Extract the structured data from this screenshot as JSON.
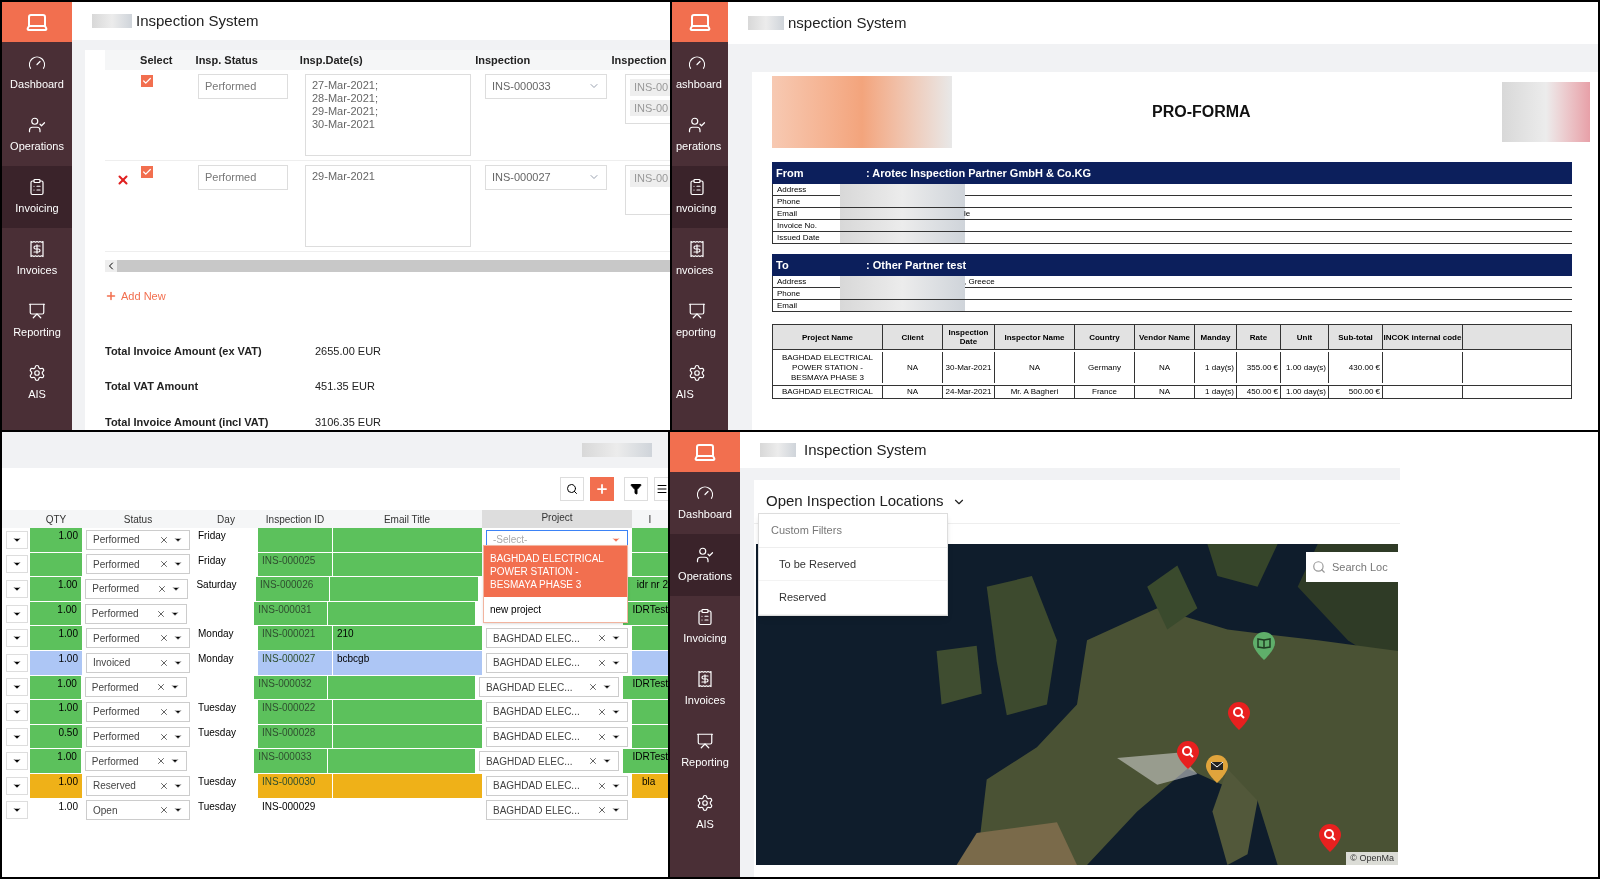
{
  "invoicing_panel": {
    "app_title": "Inspection System",
    "sidebar": [
      {
        "label": "Dashboard",
        "selected": false
      },
      {
        "label": "Operations",
        "selected": false
      },
      {
        "label": "Invoicing",
        "selected": true
      },
      {
        "label": "Invoices",
        "selected": false
      },
      {
        "label": "Reporting",
        "selected": false
      },
      {
        "label": "AIS",
        "selected": false
      }
    ],
    "columns": [
      "Select",
      "Insp. Status",
      "Insp.Date(s)",
      "Inspection",
      "Inspection"
    ],
    "rows": [
      {
        "removable": false,
        "checked": true,
        "status": "Performed",
        "dates": [
          "27-Mar-2021;",
          "28-Mar-2021;",
          "29-Mar-2021;",
          "30-Mar-2021"
        ],
        "inspection": "INS-000033",
        "linked": [
          "INS-00",
          "INS-00"
        ]
      },
      {
        "removable": true,
        "checked": true,
        "status": "Performed",
        "dates": [
          "29-Mar-2021"
        ],
        "inspection": "INS-000027",
        "linked": [
          "INS-00"
        ]
      }
    ],
    "add_new": "Add New",
    "totals": [
      {
        "label": "Total Invoice Amount (ex VAT)",
        "value": "2655.00 EUR"
      },
      {
        "label": "Total VAT Amount",
        "value": "451.35 EUR"
      },
      {
        "label": "Total Invoice Amount (incl VAT)",
        "value": "3106.35 EUR"
      }
    ]
  },
  "proforma_panel": {
    "app_title": "nspection System",
    "sidebar": [
      {
        "label": "ashboard",
        "selected": false
      },
      {
        "label": "perations",
        "selected": false
      },
      {
        "label": "nvoicing",
        "selected": true
      },
      {
        "label": "nvoices",
        "selected": false
      },
      {
        "label": "eporting",
        "selected": false
      },
      {
        "label": "AIS",
        "selected": false
      }
    ],
    "heading": "PRO-FORMA",
    "parties": [
      {
        "label": "From",
        "name": ": Arotec Inspection Partner GmbH & Co.KG",
        "fields": [
          {
            "label": "Address"
          },
          {
            "label": "Phone"
          },
          {
            "label": "Email",
            "value": "le"
          },
          {
            "label": "Invoice No."
          },
          {
            "label": "Issued Date"
          }
        ]
      },
      {
        "label": "To",
        "name": ": Other Partner test",
        "fields": [
          {
            "label": "Address",
            "value": ", Greece"
          },
          {
            "label": "Phone"
          },
          {
            "label": "Email"
          }
        ]
      }
    ],
    "columns": [
      "Project Name",
      "Client",
      "Inspection Date",
      "Inspector Name",
      "Country",
      "Vendor Name",
      "Manday",
      "Rate",
      "Unit",
      "Sub-total",
      "INCOK internal code"
    ],
    "rows": [
      [
        "BAGHDAD ELECTRICAL POWER STATION - BESMAYA PHASE 3",
        "NA",
        "30-Mar-2021",
        "NA",
        "Germany",
        "NA",
        "1 day(s)",
        "355.00 €",
        "1.00 day(s)",
        "430.00 €",
        ""
      ],
      [
        "BAGHDAD ELECTRICAL",
        "NA",
        "24-Mar-2021",
        "Mr. A Bagheri",
        "France",
        "NA",
        "1 day(s)",
        "450.00 €",
        "1.00 day(s)",
        "500.00 €",
        ""
      ]
    ]
  },
  "timesheet_panel": {
    "columns": [
      "QTY",
      "Status",
      "Day",
      "Inspection ID",
      "Email Title",
      "Project",
      "I"
    ],
    "dropdown": {
      "placeholder": "-Select-",
      "options": [
        {
          "label": "BAGHDAD ELECTRICAL POWER STATION - BESMAYA PHASE 3",
          "selected": true
        },
        {
          "label": "new project",
          "selected": false
        }
      ]
    },
    "rows": [
      {
        "qty": "1.00",
        "status": "Performed",
        "day": "Friday",
        "color": "#5cc15c",
        "project_open": true
      },
      {
        "status": "Performed",
        "day": "Friday",
        "inspection_id": "INS-000025",
        "color": "#5cc15c"
      },
      {
        "qty": "1.00",
        "status": "Performed",
        "day": "Saturday",
        "inspection_id": "INS-000026",
        "color": "#5cc15c",
        "extra": "idr nr 2"
      },
      {
        "qty": "1.00",
        "status": "Performed",
        "inspection_id": "INS-000031",
        "color": "#5cc15c",
        "extra": "IDRTest"
      },
      {
        "qty": "1.00",
        "status": "Performed",
        "day": "Monday",
        "inspection_id": "INS-000021",
        "email_title": "210",
        "project": "BAGHDAD ELEC...",
        "color": "#5cc15c"
      },
      {
        "qty": "1.00",
        "status": "Invoiced",
        "day": "Monday",
        "inspection_id": "INS-000027",
        "email_title": "bcbcgb",
        "project": "BAGHDAD ELEC...",
        "color": "#adc6f5"
      },
      {
        "qty": "1.00",
        "status": "Performed",
        "inspection_id": "INS-000032",
        "project": "BAGHDAD ELEC...",
        "color": "#5cc15c",
        "extra": "IDRTest"
      },
      {
        "qty": "1.00",
        "status": "Performed",
        "day": "Tuesday",
        "inspection_id": "INS-000022",
        "project": "BAGHDAD ELEC...",
        "color": "#5cc15c"
      },
      {
        "qty": "0.50",
        "status": "Performed",
        "day": "Tuesday",
        "inspection_id": "INS-000028",
        "project": "BAGHDAD ELEC...",
        "color": "#5cc15c"
      },
      {
        "qty": "1.00",
        "status": "Performed",
        "inspection_id": "INS-000033",
        "project": "BAGHDAD ELEC...",
        "color": "#5cc15c",
        "extra": "IDRTest"
      },
      {
        "qty": "1.00",
        "status": "Reserved",
        "day": "Tuesday",
        "inspection_id": "INS-000030",
        "project": "BAGHDAD ELEC...",
        "color": "#efb118",
        "extra": "bla"
      },
      {
        "qty": "1.00",
        "status": "Open",
        "day": "Tuesday",
        "inspection_id": "INS-000029",
        "project": "BAGHDAD ELEC...",
        "color": "#ffffff"
      }
    ]
  },
  "map_panel": {
    "app_title": "Inspection System",
    "sidebar": [
      {
        "label": "Dashboard",
        "selected": false
      },
      {
        "label": "Operations",
        "selected": true
      },
      {
        "label": "Invoicing",
        "selected": false
      },
      {
        "label": "Invoices",
        "selected": false
      },
      {
        "label": "Reporting",
        "selected": false
      },
      {
        "label": "AIS",
        "selected": false
      }
    ],
    "title": "Open Inspection Locations",
    "filter_menu": {
      "heading": "Custom Filters",
      "items": [
        "To be Reserved",
        "Reserved"
      ]
    },
    "search": {
      "placeholder": "Search Loc"
    },
    "attribution": "© OpenMa",
    "markers": [
      {
        "kind": "book",
        "color": "#5fae6a"
      },
      {
        "kind": "search",
        "color": "#e8201f"
      },
      {
        "kind": "search",
        "color": "#e8201f"
      },
      {
        "kind": "mail",
        "color": "#e0a43c"
      },
      {
        "kind": "search",
        "color": "#e8201f"
      }
    ]
  }
}
